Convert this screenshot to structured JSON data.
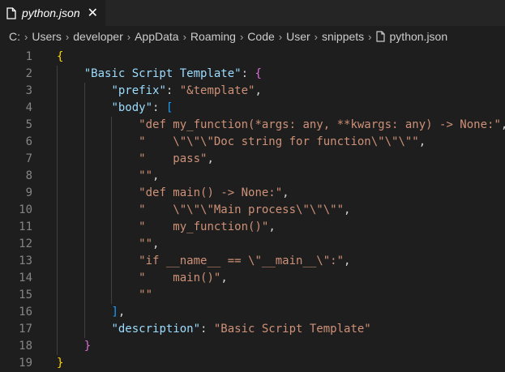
{
  "tab": {
    "label": "python.json",
    "close_glyph": "✕",
    "icon": "file-icon"
  },
  "breadcrumb": {
    "parts": [
      "C:",
      "Users",
      "developer",
      "AppData",
      "Roaming",
      "Code",
      "User",
      "snippets",
      "python.json"
    ],
    "separator": "›"
  },
  "colors": {
    "background": "#1e1e1e",
    "key": "#9cdcfe",
    "string": "#ce9178",
    "punctuation": "#d4d4d4",
    "brace_level1": "#ffd700",
    "brace_level2": "#da70d6",
    "bracket_level3": "#179fff",
    "line_number": "#858585"
  },
  "editor": {
    "lines": [
      {
        "n": "1",
        "t": [
          [
            "b1",
            "{"
          ]
        ]
      },
      {
        "n": "2",
        "t": [
          [
            "k",
            "\"Basic Script Template\""
          ],
          [
            "p",
            ": "
          ],
          [
            "b2",
            "{"
          ]
        ]
      },
      {
        "n": "3",
        "t": [
          [
            "k",
            "\"prefix\""
          ],
          [
            "p",
            ": "
          ],
          [
            "s",
            "\"&template\""
          ],
          [
            "p",
            ","
          ]
        ]
      },
      {
        "n": "4",
        "t": [
          [
            "k",
            "\"body\""
          ],
          [
            "p",
            ": "
          ],
          [
            "b3",
            "["
          ]
        ]
      },
      {
        "n": "5",
        "t": [
          [
            "s",
            "\"def my_function(*args: any, **kwargs: any) -> None:\""
          ],
          [
            "p",
            ","
          ]
        ]
      },
      {
        "n": "6",
        "t": [
          [
            "s",
            "\"    \\\"\\\"\\\"Doc string for function\\\"\\\"\\\"\""
          ],
          [
            "p",
            ","
          ]
        ]
      },
      {
        "n": "7",
        "t": [
          [
            "s",
            "\"    pass\""
          ],
          [
            "p",
            ","
          ]
        ]
      },
      {
        "n": "8",
        "t": [
          [
            "s",
            "\"\""
          ],
          [
            "p",
            ","
          ]
        ]
      },
      {
        "n": "9",
        "t": [
          [
            "s",
            "\"def main() -> None:\""
          ],
          [
            "p",
            ","
          ]
        ]
      },
      {
        "n": "10",
        "t": [
          [
            "s",
            "\"    \\\"\\\"\\\"Main process\\\"\\\"\\\"\""
          ],
          [
            "p",
            ","
          ]
        ]
      },
      {
        "n": "11",
        "t": [
          [
            "s",
            "\"    my_function()\""
          ],
          [
            "p",
            ","
          ]
        ]
      },
      {
        "n": "12",
        "t": [
          [
            "s",
            "\"\""
          ],
          [
            "p",
            ","
          ]
        ]
      },
      {
        "n": "13",
        "t": [
          [
            "s",
            "\"if __name__ == \\\"__main__\\\":\""
          ],
          [
            "p",
            ","
          ]
        ]
      },
      {
        "n": "14",
        "t": [
          [
            "s",
            "\"    main()\""
          ],
          [
            "p",
            ","
          ]
        ]
      },
      {
        "n": "15",
        "t": [
          [
            "s",
            "\"\""
          ]
        ]
      },
      {
        "n": "16",
        "t": [
          [
            "b3",
            "]"
          ],
          [
            "p",
            ","
          ]
        ]
      },
      {
        "n": "17",
        "t": [
          [
            "k",
            "\"description\""
          ],
          [
            "p",
            ": "
          ],
          [
            "s",
            "\"Basic Script Template\""
          ]
        ]
      },
      {
        "n": "18",
        "t": [
          [
            "b2",
            "}"
          ]
        ]
      },
      {
        "n": "19",
        "t": [
          [
            "b1",
            "}"
          ]
        ]
      }
    ]
  }
}
